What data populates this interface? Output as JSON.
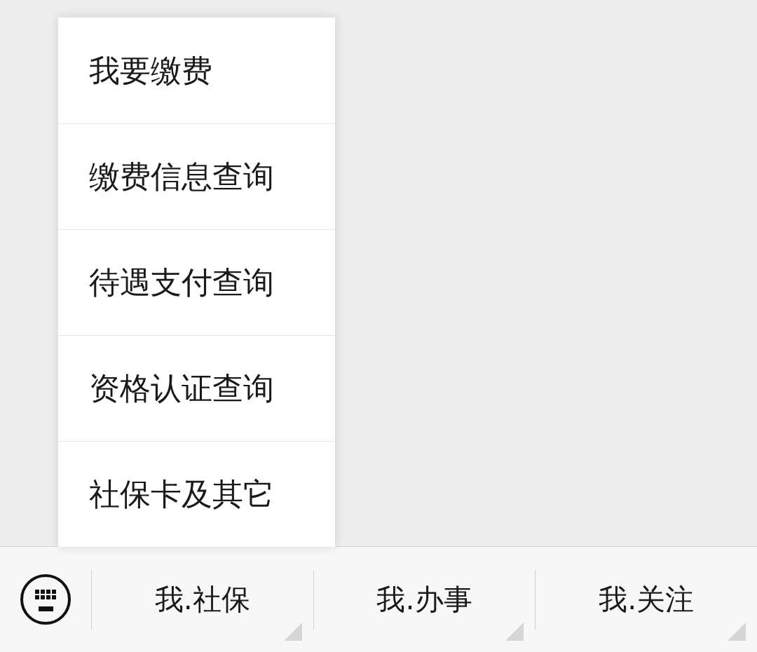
{
  "popup_menu": {
    "items": [
      "我要缴费",
      "缴费信息查询",
      "待遇支付查询",
      "资格认证查询",
      "社保卡及其它"
    ]
  },
  "bottom_bar": {
    "menus": [
      "我.社保",
      "我.办事",
      "我.关注"
    ]
  }
}
